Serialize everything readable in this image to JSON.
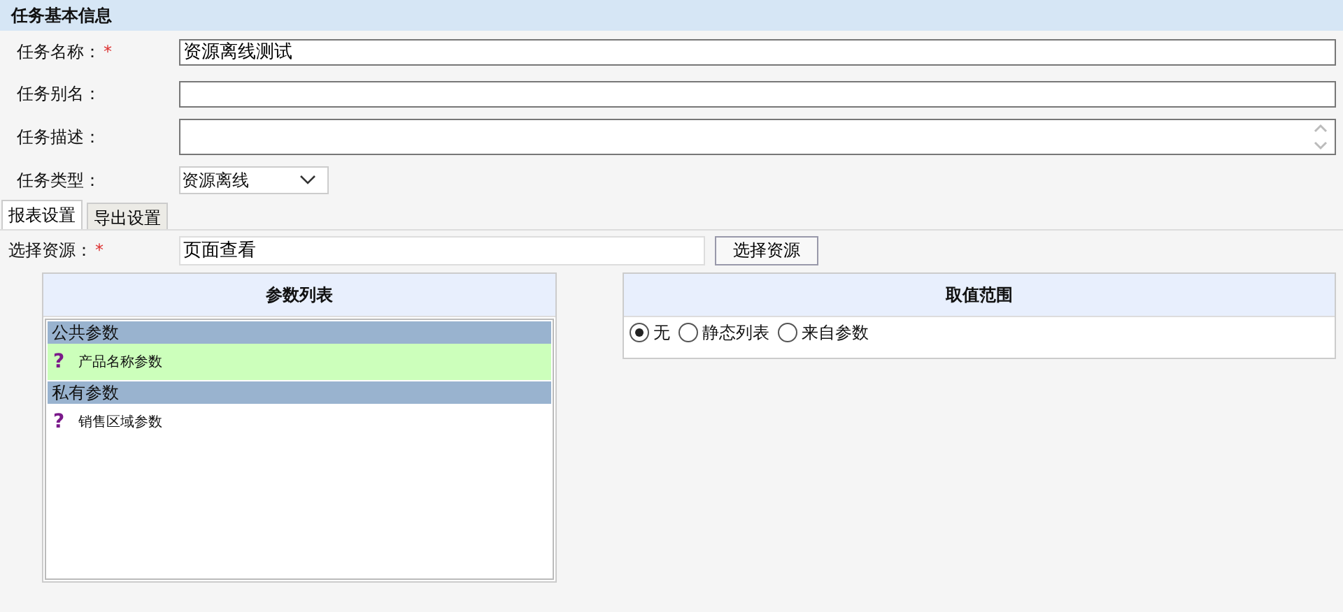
{
  "section_title": "任务基本信息",
  "fields": [
    {
      "kind": "text",
      "label": "任务名称：",
      "mark": "*",
      "value": "资源离线测试"
    },
    {
      "kind": "text",
      "label": "任务别名："
    },
    {
      "kind": "textarea",
      "label": "任务描述："
    },
    {
      "kind": "select",
      "label": "任务类型：",
      "value": "资源离线"
    }
  ],
  "tabs": [
    {
      "label": "报表设置",
      "selected": true
    },
    {
      "label": "导出设置",
      "selected": false
    }
  ],
  "resource": {
    "label": "选择资源：",
    "mark": "*",
    "value": "页面查看",
    "button": "选择资源"
  },
  "param_list": {
    "title": "参数列表",
    "groups": [
      {
        "name": "公共参数",
        "items": [
          {
            "label": "产品名称参数",
            "icon": "?",
            "selected": true
          }
        ]
      },
      {
        "name": "私有参数",
        "items": [
          {
            "label": "销售区域参数",
            "icon": "?",
            "selected": false
          }
        ]
      }
    ]
  },
  "value_range": {
    "title": "取值范围",
    "options": [
      {
        "label": "无",
        "selected": true
      },
      {
        "label": "静态列表",
        "selected": false
      },
      {
        "label": "来自参数",
        "selected": false
      }
    ]
  }
}
